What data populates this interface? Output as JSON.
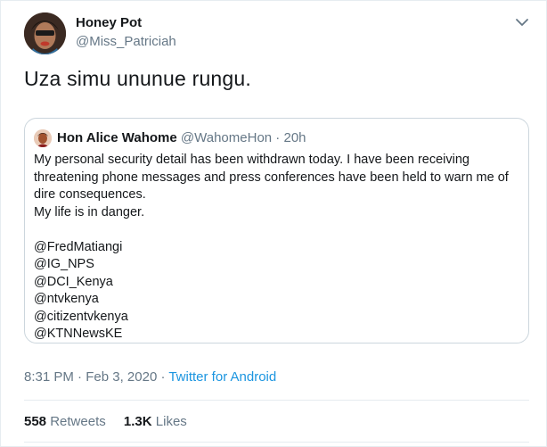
{
  "author": {
    "name": "Honey Pot",
    "handle": "@Miss_Patriciah"
  },
  "tweet": {
    "text": "Uza simu ununue rungu."
  },
  "quoted": {
    "name": "Hon Alice Wahome",
    "handle": "@WahomeHon",
    "separator": " · ",
    "time_ago": "20h",
    "lines": [
      "My personal security detail has been withdrawn today. I have been receiving",
      "threatening phone messages and press conferences have been held to warn me of",
      "dire consequences.",
      "My life is in danger."
    ],
    "mentions": [
      "@FredMatiangi",
      "@IG_NPS",
      "@DCI_Kenya",
      "@ntvkenya",
      "@citizentvkenya",
      "@KTNNewsKE"
    ]
  },
  "meta": {
    "time": "8:31 PM",
    "sep1": " · ",
    "date": "Feb 3, 2020",
    "sep2": " · ",
    "source": "Twitter for Android"
  },
  "stats": {
    "retweets_count": "558",
    "retweets_label": "Retweets",
    "likes_count": "1.3K",
    "likes_label": "Likes"
  },
  "colors": {
    "link": "#1b95e0",
    "secondary_text": "#657786",
    "border": "#ccd6dd"
  },
  "icons": {
    "caret": "chevron-down-icon"
  }
}
